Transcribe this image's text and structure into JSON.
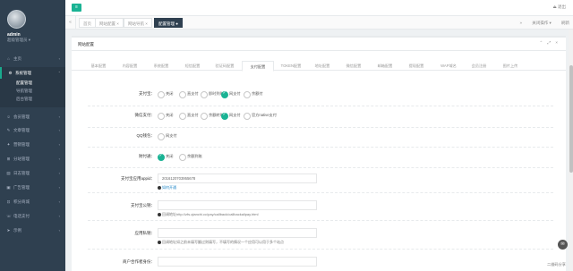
{
  "user": {
    "name": "admin",
    "role": "超级管理员 ▾"
  },
  "sidebar": {
    "items": [
      {
        "label": "主页",
        "icon": "home-icon"
      },
      {
        "label": "系统管理",
        "icon": "gear-icon",
        "active": true
      },
      {
        "label": "会员管理",
        "icon": "user-icon"
      },
      {
        "label": "文章管理",
        "icon": "edit-icon"
      },
      {
        "label": "营销管理",
        "icon": "gift-icon"
      },
      {
        "label": "分站管理",
        "icon": "sitemap-icon"
      },
      {
        "label": "日志管理",
        "icon": "file-icon"
      },
      {
        "label": "广告管理",
        "icon": "image-icon"
      },
      {
        "label": "积分商城",
        "icon": "shop-icon"
      },
      {
        "label": "电话支付",
        "icon": "phone-icon"
      },
      {
        "label": "示例",
        "icon": "paper-plane-icon"
      }
    ],
    "subitems": [
      {
        "label": "配置管理",
        "current": true
      },
      {
        "label": "导航管理"
      },
      {
        "label": "后台管理"
      }
    ]
  },
  "topbar": {
    "right": "退出"
  },
  "tabs": {
    "items": [
      {
        "label": "首页"
      },
      {
        "label": "网站配置 ×"
      },
      {
        "label": "网站导航 ×"
      },
      {
        "label": "配置管理 ●",
        "current": true
      }
    ],
    "tools": [
      "关闭操作 ▾",
      "刷新"
    ]
  },
  "panel": {
    "title": "网站配置",
    "tools": "⌃ ⤢ ×",
    "subtabs": [
      "基本配置",
      "内容配置",
      "系统配置",
      "短信配置",
      "验证码配置",
      "支付配置",
      "TOKEN配置",
      "地址配置",
      "微信配置",
      "邮箱配置",
      "提现配置",
      "WAP域名",
      "会员注册",
      "图片上传"
    ],
    "current_subtab": 5
  },
  "form": {
    "alipay": {
      "label": "支付宝：",
      "options": [
        "关闭",
        "直支付",
        "即时到账",
        "网支付",
        "余额付"
      ],
      "selected": 3
    },
    "wechat": {
      "label": "微信支付：",
      "options": [
        "关闭",
        "直支付",
        "余额转账",
        "网支付",
        "官方native支付"
      ],
      "selected": 3
    },
    "qq": {
      "label": "QQ钱包：",
      "options": [
        "网支付"
      ],
      "selected": -1
    },
    "tenpay": {
      "label": "财付通：",
      "options": [
        "关闭",
        "余额到账"
      ],
      "selected": 0
    },
    "appid": {
      "label": "支付宝应用appid：",
      "value": "2016120703955678",
      "help_link": "如何开通"
    },
    "pubkey": {
      "label": "支付宝公钥：",
      "help": "回调地址http://zfs.qianchi.cc/pay/callback/callbackalipay.html"
    },
    "privkey": {
      "label": "应用私钥：",
      "help": "回调地址如之前未填写翻过则填写，不填写的情况一个应用可以用于多个站点"
    },
    "next": {
      "label": "商户合作者身份："
    }
  },
  "footer": "二维码分享"
}
